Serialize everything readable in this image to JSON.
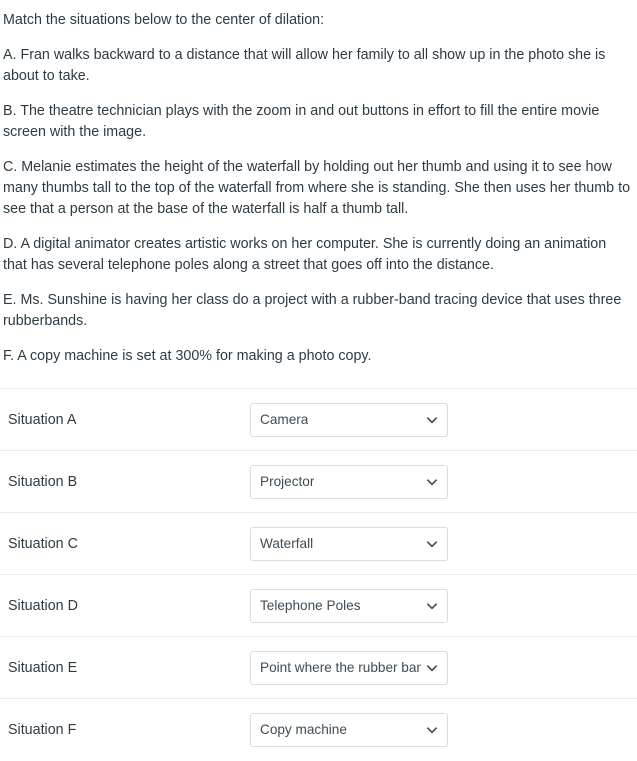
{
  "question": {
    "prompt": "Match the situations below to the center of dilation:",
    "items": [
      "A. Fran walks backward to a distance that will allow her family to all show up in the photo she is about to take.",
      "B. The theatre technician plays with the zoom in and out buttons in effort to fill the entire movie screen with the image.",
      "C. Melanie estimates the height of the waterfall by holding out her thumb and using it to see how many thumbs tall to the top of the waterfall from where she is standing. She then uses her thumb to see that a person at the base of the waterfall is half a thumb tall.",
      "D. A digital animator creates artistic works on her computer. She is currently doing an animation that has several telephone poles along a street that goes off into the distance.",
      "E. Ms. Sunshine is having her class do a project with a rubber-band tracing device that uses three rubberbands.",
      "F. A copy machine is set at 300% for making a photo copy."
    ]
  },
  "matching": {
    "rows": [
      {
        "label": "Situation A",
        "selected": "Camera",
        "icon": "chevron-down-icon"
      },
      {
        "label": "Situation B",
        "selected": "Projector",
        "icon": "chevron-down-icon"
      },
      {
        "label": "Situation C",
        "selected": "Waterfall",
        "icon": "chevron-down-icon"
      },
      {
        "label": "Situation D",
        "selected": "Telephone Poles",
        "icon": "chevron-down-icon"
      },
      {
        "label": "Situation E",
        "selected": "Point where the rubber bands meet",
        "icon": "chevron-down-icon"
      },
      {
        "label": "Situation F",
        "selected": "Copy machine",
        "icon": "chevron-down-icon"
      }
    ]
  },
  "colors": {
    "text": "#2d3b45",
    "border": "#e8eaec",
    "select_border": "#d8dbdf",
    "background": "#ffffff"
  }
}
